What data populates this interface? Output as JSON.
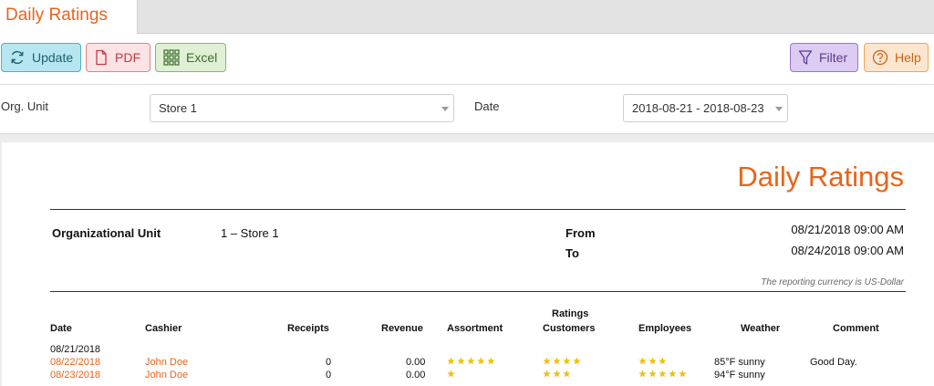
{
  "tab": {
    "title": "Daily Ratings"
  },
  "toolbar": {
    "update_label": "Update",
    "pdf_label": "PDF",
    "excel_label": "Excel",
    "filter_label": "Filter",
    "help_label": "Help"
  },
  "filters": {
    "org_unit_label": "Org. Unit",
    "org_unit_value": "Store 1",
    "date_label": "Date",
    "date_value": "2018-08-21 - 2018-08-23"
  },
  "report": {
    "title": "Daily Ratings",
    "org_unit_label": "Organizational Unit",
    "org_unit_value": "1 – Store 1",
    "from_label": "From",
    "from_value": "08/21/2018 09:00 AM",
    "to_label": "To",
    "to_value": "08/24/2018 09:00 AM",
    "currency_note": "The reporting currency is US-Dollar",
    "ratings_group_label": "Ratings",
    "columns": {
      "date": "Date",
      "cashier": "Cashier",
      "receipts": "Receipts",
      "revenue": "Revenue",
      "assortment": "Assortment",
      "customers": "Customers",
      "employees": "Employees",
      "weather": "Weather",
      "comment": "Comment"
    },
    "group_date": "08/21/2018",
    "rows": [
      {
        "date": "08/22/2018",
        "cashier": "John Doe",
        "receipts": "0",
        "revenue": "0.00",
        "assortment": 5,
        "customers": 4,
        "employees": 3,
        "weather": "85°F sunny",
        "comment": "Good Day."
      },
      {
        "date": "08/23/2018",
        "cashier": "John Doe",
        "receipts": "0",
        "revenue": "0.00",
        "assortment": 1,
        "customers": 3,
        "employees": 5,
        "weather": "94°F sunny",
        "comment": ""
      }
    ]
  },
  "colors": {
    "accent": "#e8641b",
    "star": "#f2c200"
  }
}
